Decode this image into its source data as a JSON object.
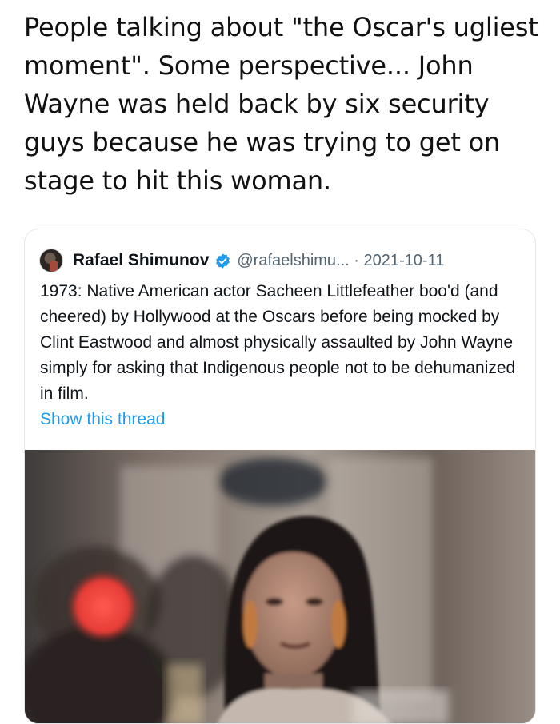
{
  "post": {
    "text": "People talking about \"the Oscar's ugliest moment\". Some perspective... John Wayne was held back by six security guys because he was trying to get on stage to hit this woman."
  },
  "quote": {
    "author_name": "Rafael Shimunov",
    "handle": "@rafaelshimu...",
    "separator": "·",
    "date": "2021-10-11",
    "body": "1973: Native American actor Sacheen Littlefeather boo'd (and cheered) by Hollywood at the Oscars before being mocked by Clint Eastwood and almost physically assaulted by John Wayne simply for asking that Indigenous people not to be dehumanized in film.",
    "show_thread": "Show this thread"
  },
  "colors": {
    "link": "#1d9bf0",
    "verified": "#1d9bf0",
    "muted": "#536471"
  },
  "icons": {
    "verified": "verified-badge-icon",
    "avatar": "avatar"
  }
}
